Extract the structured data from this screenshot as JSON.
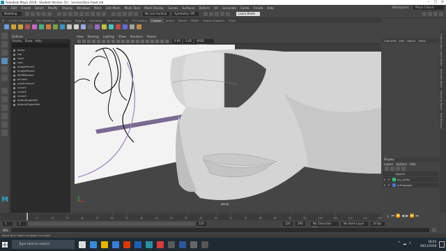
{
  "window": {
    "title": "Autodesk Maya 2018 - Student Version: D:\\...\\scenes\\face head.mb"
  },
  "menubar": {
    "items": [
      "File",
      "Edit",
      "Create",
      "Select",
      "Modify",
      "Display",
      "Windows",
      "Mesh",
      "Edit Mesh",
      "Mesh Tools",
      "Mesh Display",
      "Curves",
      "Surfaces",
      "Deform",
      "UV",
      "Generate",
      "Cache",
      "Arnold",
      "Help"
    ],
    "workspace_label": "Workspace:",
    "workspace_value": "Maya Classic"
  },
  "statusline": {
    "mode": "Modeling",
    "live_surface": "No Live Surface",
    "symmetry": "Symmetry: Off",
    "user": "Laura Boote"
  },
  "shelf": {
    "tabs": [
      "Curves / Surfaces",
      "Poly Modeling",
      "Sculpting",
      "Rigging",
      "Animation",
      "Rendering",
      "FX",
      "FX Caching",
      "Custom",
      "Arnold",
      "Bifrost",
      "MASH",
      "Motion Graphics",
      "XGen"
    ],
    "active_tab": "Custom"
  },
  "outliner": {
    "title": "Outliner",
    "menus": [
      "Display",
      "Show",
      "Help"
    ],
    "items": [
      "persp",
      "top",
      "front",
      "side",
      "imagePlane1",
      "imagePlane2",
      "NURBSplane",
      "pCube1",
      "polySurface1",
      "curve1",
      "curve2",
      "curve3",
      "defaultLightSet",
      "defaultObjectSet"
    ]
  },
  "viewport": {
    "menus": [
      "View",
      "Shading",
      "Lighting",
      "Show",
      "Renderer",
      "Panels"
    ],
    "colorspace": "sRGB gamma",
    "camera_label": "persp",
    "values": [
      "0.00",
      "1.00"
    ]
  },
  "channelbox": {
    "tabs": [
      "Channels",
      "Edit",
      "Object",
      "Show"
    ]
  },
  "layers": {
    "title": "Display",
    "menus": [
      "Layers",
      "Options",
      "Help"
    ],
    "header": "Object1",
    "rows": [
      {
        "v": "V",
        "p": "P",
        "name": "lay_stuffs",
        "color": "#2fbf6a"
      },
      {
        "v": "V",
        "p": "P",
        "name": "orthograph",
        "color": "#4a72c8"
      }
    ]
  },
  "rightstrip": {
    "labels": [
      "Channel Box / Layer Editor",
      "Attribute Editor",
      "Modeling Toolkit",
      "Tool Settings"
    ]
  },
  "timeline": {
    "ticks": [
      "5",
      "10",
      "15",
      "20",
      "25",
      "30",
      "35",
      "40",
      "45",
      "50",
      "55",
      "60",
      "65",
      "70",
      "75",
      "80",
      "85",
      "90",
      "95",
      "100",
      "105",
      "110",
      "115",
      "120"
    ],
    "current_frame": "1"
  },
  "range": {
    "start": "1",
    "inner_start": "1",
    "inner_end": "120",
    "end": "120",
    "end2": "200",
    "fps": "24 fps",
    "char_set": "No Character Set",
    "anim_layer": "No Anim Layer"
  },
  "cmdline": {
    "label": "MEL"
  },
  "helpline": {
    "text": "Move Tool: Select an object to move."
  },
  "taskbar": {
    "search_placeholder": "Type here to search",
    "time": "18:54",
    "date": "20/11/2018"
  }
}
